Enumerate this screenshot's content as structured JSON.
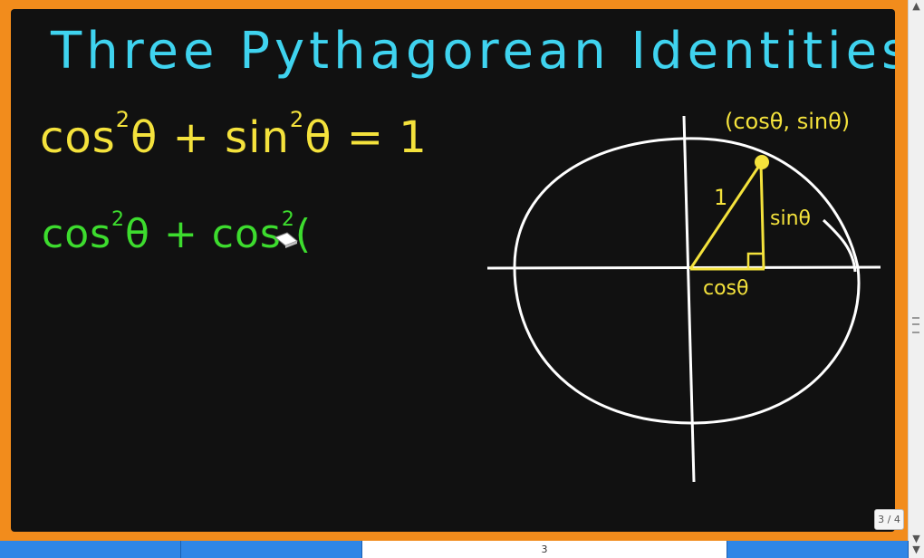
{
  "board": {
    "title": "Three Pythagorean Identities",
    "equation1": {
      "a": "cos",
      "sup1": "2",
      "b": "θ + sin",
      "sup2": "2",
      "c": "θ = 1"
    },
    "equation2": {
      "a": "cos",
      "sup1": "2",
      "b": "θ + cos",
      "sup2": "2",
      "c": "("
    }
  },
  "diagram": {
    "point_label": "(cosθ, sinθ)",
    "hypotenuse_label": "1",
    "opposite_label": "sinθ",
    "adjacent_label": "cosθ",
    "colors": {
      "circle": "#ffffff",
      "triangle": "#f4e23c",
      "axes": "#ffffff"
    }
  },
  "viewer": {
    "page_counter": "3 / 4",
    "active_page": "3"
  }
}
